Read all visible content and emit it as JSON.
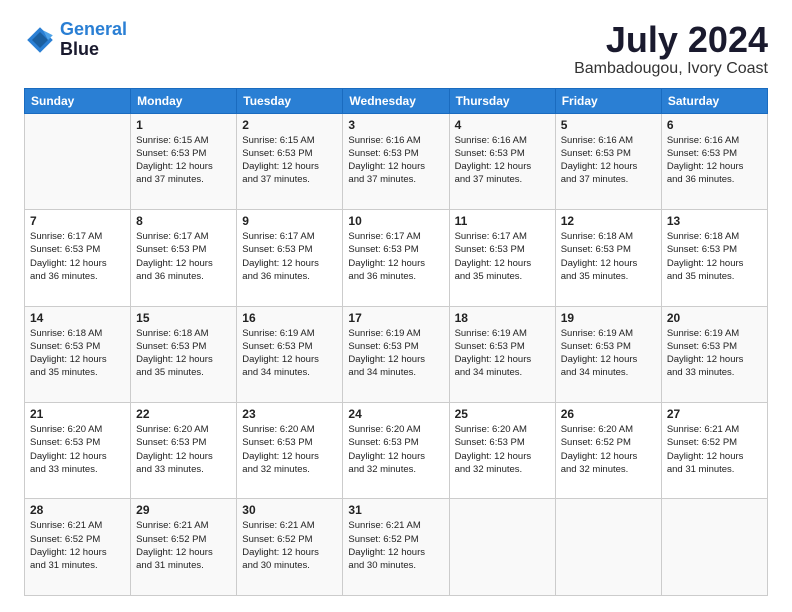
{
  "logo": {
    "line1": "General",
    "line2": "Blue"
  },
  "title": "July 2024",
  "location": "Bambadougou, Ivory Coast",
  "days_header": [
    "Sunday",
    "Monday",
    "Tuesday",
    "Wednesday",
    "Thursday",
    "Friday",
    "Saturday"
  ],
  "weeks": [
    [
      {
        "num": "",
        "info": ""
      },
      {
        "num": "1",
        "info": "Sunrise: 6:15 AM\nSunset: 6:53 PM\nDaylight: 12 hours\nand 37 minutes."
      },
      {
        "num": "2",
        "info": "Sunrise: 6:15 AM\nSunset: 6:53 PM\nDaylight: 12 hours\nand 37 minutes."
      },
      {
        "num": "3",
        "info": "Sunrise: 6:16 AM\nSunset: 6:53 PM\nDaylight: 12 hours\nand 37 minutes."
      },
      {
        "num": "4",
        "info": "Sunrise: 6:16 AM\nSunset: 6:53 PM\nDaylight: 12 hours\nand 37 minutes."
      },
      {
        "num": "5",
        "info": "Sunrise: 6:16 AM\nSunset: 6:53 PM\nDaylight: 12 hours\nand 37 minutes."
      },
      {
        "num": "6",
        "info": "Sunrise: 6:16 AM\nSunset: 6:53 PM\nDaylight: 12 hours\nand 36 minutes."
      }
    ],
    [
      {
        "num": "7",
        "info": "Sunrise: 6:17 AM\nSunset: 6:53 PM\nDaylight: 12 hours\nand 36 minutes."
      },
      {
        "num": "8",
        "info": "Sunrise: 6:17 AM\nSunset: 6:53 PM\nDaylight: 12 hours\nand 36 minutes."
      },
      {
        "num": "9",
        "info": "Sunrise: 6:17 AM\nSunset: 6:53 PM\nDaylight: 12 hours\nand 36 minutes."
      },
      {
        "num": "10",
        "info": "Sunrise: 6:17 AM\nSunset: 6:53 PM\nDaylight: 12 hours\nand 36 minutes."
      },
      {
        "num": "11",
        "info": "Sunrise: 6:17 AM\nSunset: 6:53 PM\nDaylight: 12 hours\nand 35 minutes."
      },
      {
        "num": "12",
        "info": "Sunrise: 6:18 AM\nSunset: 6:53 PM\nDaylight: 12 hours\nand 35 minutes."
      },
      {
        "num": "13",
        "info": "Sunrise: 6:18 AM\nSunset: 6:53 PM\nDaylight: 12 hours\nand 35 minutes."
      }
    ],
    [
      {
        "num": "14",
        "info": "Sunrise: 6:18 AM\nSunset: 6:53 PM\nDaylight: 12 hours\nand 35 minutes."
      },
      {
        "num": "15",
        "info": "Sunrise: 6:18 AM\nSunset: 6:53 PM\nDaylight: 12 hours\nand 35 minutes."
      },
      {
        "num": "16",
        "info": "Sunrise: 6:19 AM\nSunset: 6:53 PM\nDaylight: 12 hours\nand 34 minutes."
      },
      {
        "num": "17",
        "info": "Sunrise: 6:19 AM\nSunset: 6:53 PM\nDaylight: 12 hours\nand 34 minutes."
      },
      {
        "num": "18",
        "info": "Sunrise: 6:19 AM\nSunset: 6:53 PM\nDaylight: 12 hours\nand 34 minutes."
      },
      {
        "num": "19",
        "info": "Sunrise: 6:19 AM\nSunset: 6:53 PM\nDaylight: 12 hours\nand 34 minutes."
      },
      {
        "num": "20",
        "info": "Sunrise: 6:19 AM\nSunset: 6:53 PM\nDaylight: 12 hours\nand 33 minutes."
      }
    ],
    [
      {
        "num": "21",
        "info": "Sunrise: 6:20 AM\nSunset: 6:53 PM\nDaylight: 12 hours\nand 33 minutes."
      },
      {
        "num": "22",
        "info": "Sunrise: 6:20 AM\nSunset: 6:53 PM\nDaylight: 12 hours\nand 33 minutes."
      },
      {
        "num": "23",
        "info": "Sunrise: 6:20 AM\nSunset: 6:53 PM\nDaylight: 12 hours\nand 32 minutes."
      },
      {
        "num": "24",
        "info": "Sunrise: 6:20 AM\nSunset: 6:53 PM\nDaylight: 12 hours\nand 32 minutes."
      },
      {
        "num": "25",
        "info": "Sunrise: 6:20 AM\nSunset: 6:53 PM\nDaylight: 12 hours\nand 32 minutes."
      },
      {
        "num": "26",
        "info": "Sunrise: 6:20 AM\nSunset: 6:52 PM\nDaylight: 12 hours\nand 32 minutes."
      },
      {
        "num": "27",
        "info": "Sunrise: 6:21 AM\nSunset: 6:52 PM\nDaylight: 12 hours\nand 31 minutes."
      }
    ],
    [
      {
        "num": "28",
        "info": "Sunrise: 6:21 AM\nSunset: 6:52 PM\nDaylight: 12 hours\nand 31 minutes."
      },
      {
        "num": "29",
        "info": "Sunrise: 6:21 AM\nSunset: 6:52 PM\nDaylight: 12 hours\nand 31 minutes."
      },
      {
        "num": "30",
        "info": "Sunrise: 6:21 AM\nSunset: 6:52 PM\nDaylight: 12 hours\nand 30 minutes."
      },
      {
        "num": "31",
        "info": "Sunrise: 6:21 AM\nSunset: 6:52 PM\nDaylight: 12 hours\nand 30 minutes."
      },
      {
        "num": "",
        "info": ""
      },
      {
        "num": "",
        "info": ""
      },
      {
        "num": "",
        "info": ""
      }
    ]
  ]
}
